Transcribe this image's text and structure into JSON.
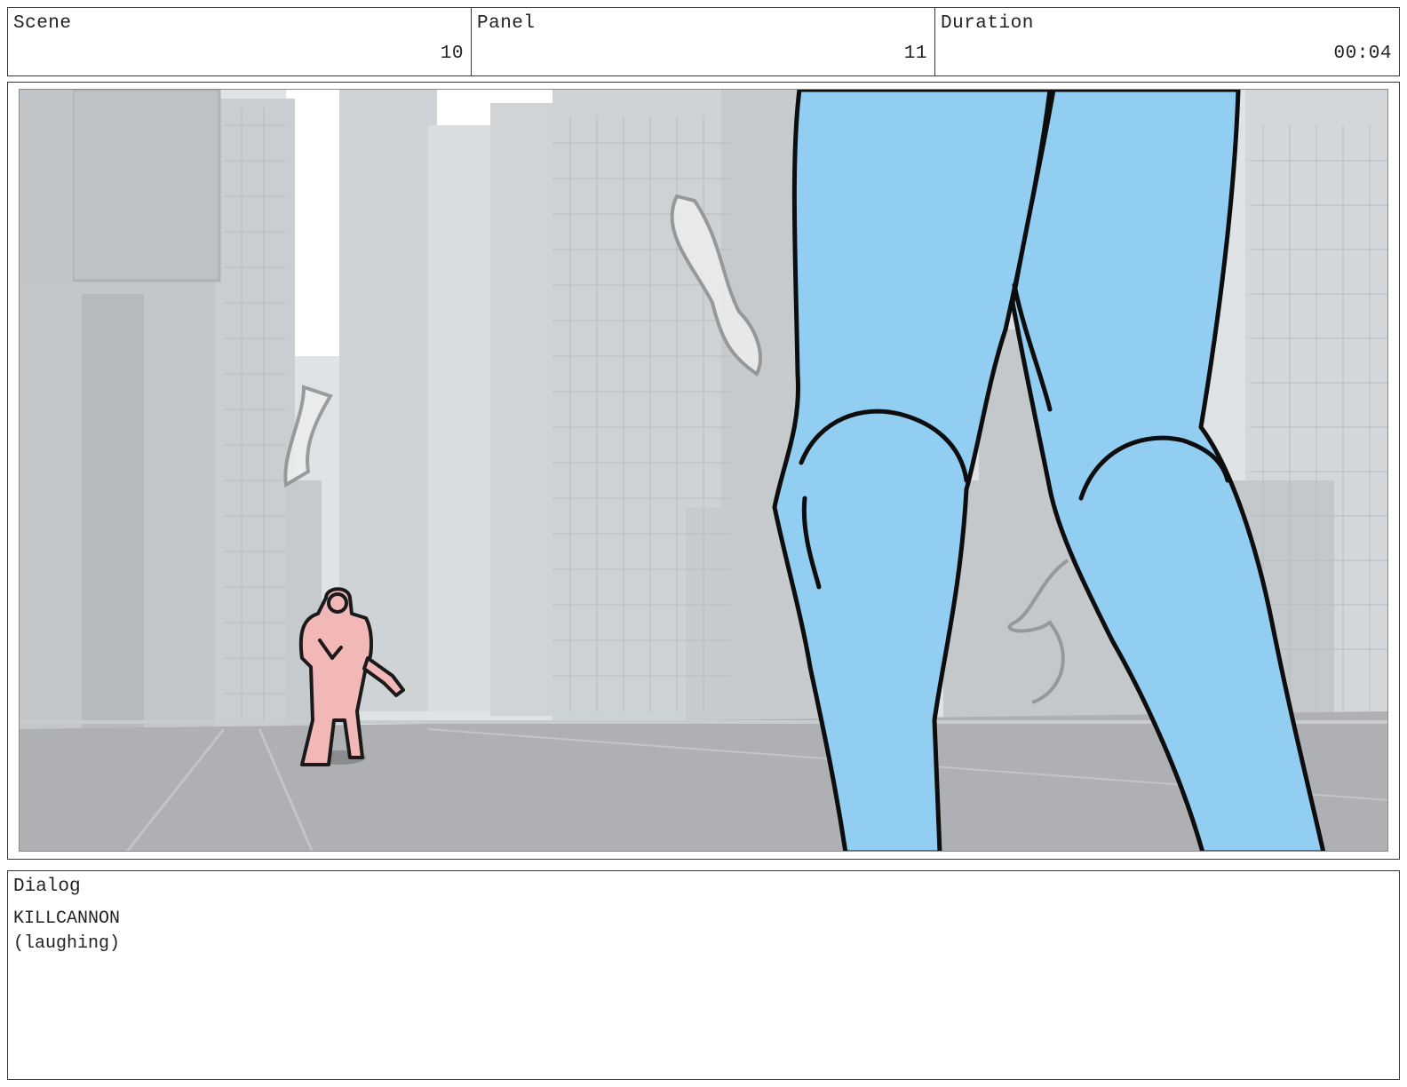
{
  "header": {
    "scene": {
      "label": "Scene",
      "value": "10"
    },
    "panel": {
      "label": "Panel",
      "value": "11"
    },
    "duration": {
      "label": "Duration",
      "value": "00:04"
    }
  },
  "dialog": {
    "label": "Dialog",
    "speaker": "KILLCANNON",
    "direction": "(laughing)"
  },
  "colors": {
    "giant_legs": "#92cdf2",
    "armored_figure": "#f2b8b8",
    "city_background": "#c9cdd0"
  }
}
